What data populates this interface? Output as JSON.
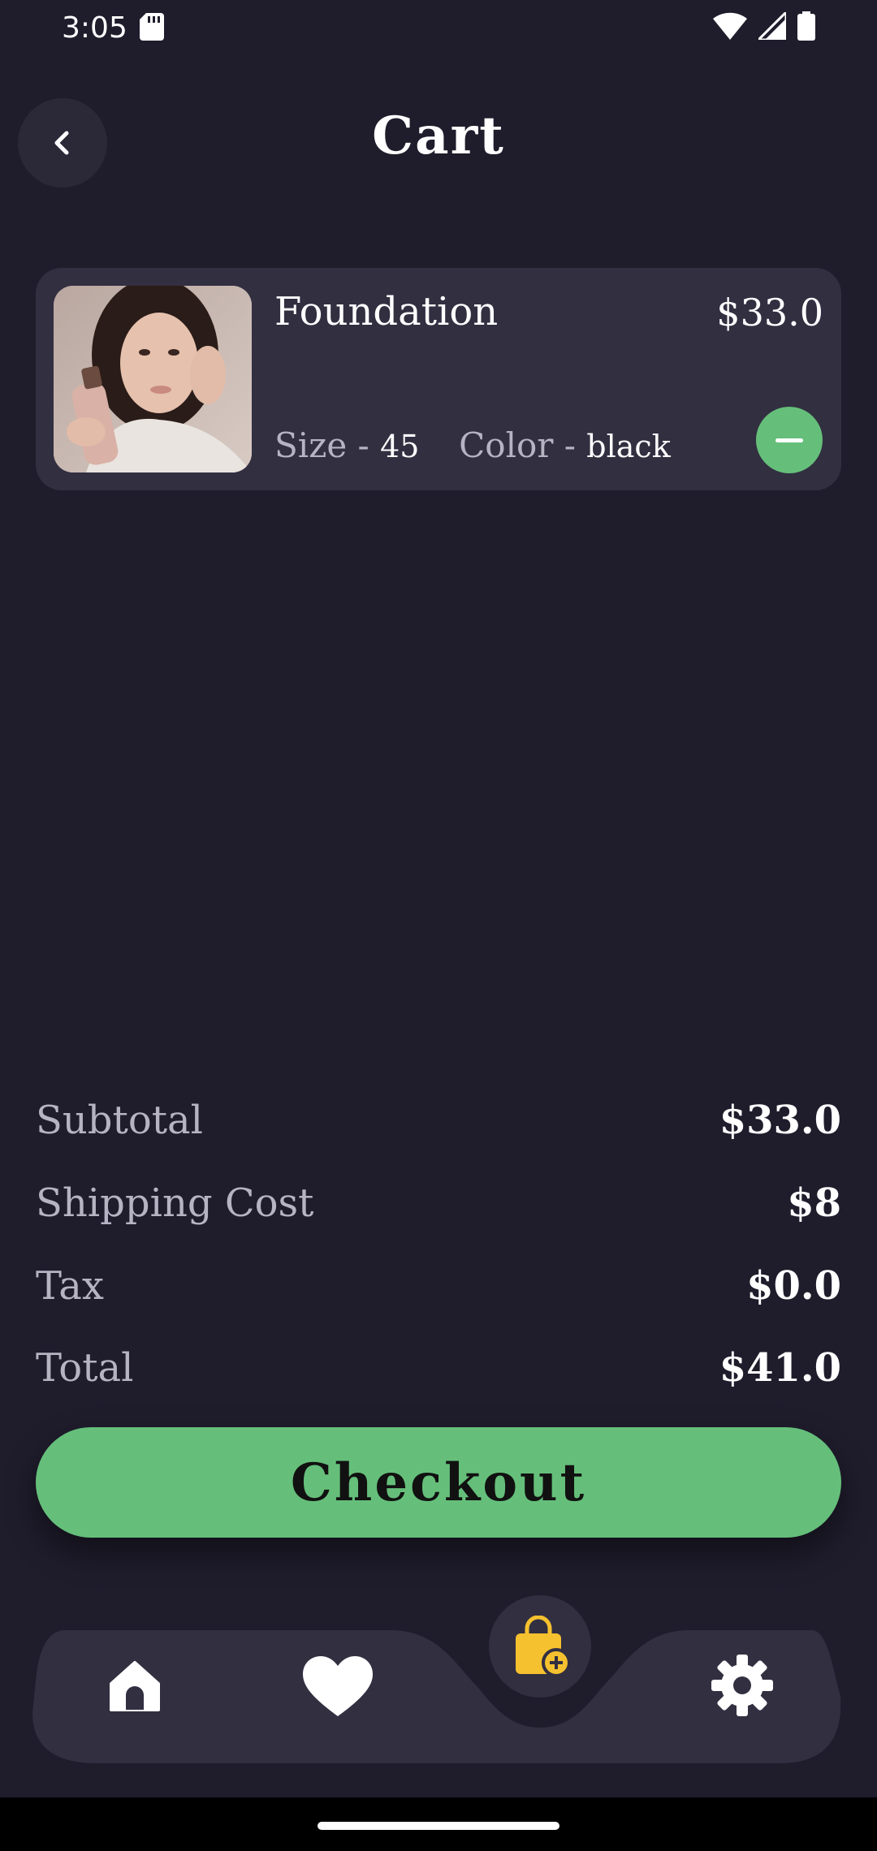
{
  "status_bar": {
    "time": "3:05",
    "icons": [
      "sd-card-icon",
      "wifi-icon",
      "signal-icon",
      "battery-icon"
    ]
  },
  "header": {
    "title": "Cart",
    "back_icon": "chevron-left-icon"
  },
  "cart": {
    "items": [
      {
        "name": "Foundation",
        "price": "$33.0",
        "size_label": "Size - ",
        "size_value": "45",
        "color_label": "Color - ",
        "color_value": "black",
        "image": "product-photo",
        "remove_icon": "minus-icon"
      }
    ]
  },
  "summary": {
    "subtotal_label": "Subtotal",
    "subtotal_value": "$33.0",
    "shipping_label": "Shipping Cost",
    "shipping_value": "$8",
    "tax_label": "Tax",
    "tax_value": "$0.0",
    "total_label": "Total",
    "total_value": "$41.0"
  },
  "checkout": {
    "label": "Checkout"
  },
  "bottom_nav": {
    "items": [
      "home-icon",
      "heart-icon",
      "shopping-bag-add-icon",
      "settings-icon"
    ],
    "active": "shopping-bag-add-icon"
  },
  "colors": {
    "background": "#1f1c2c",
    "card": "#322f41",
    "accent_green": "#65bf7a",
    "active_icon": "#f5c12e",
    "muted_text": "#b6b3c2"
  }
}
